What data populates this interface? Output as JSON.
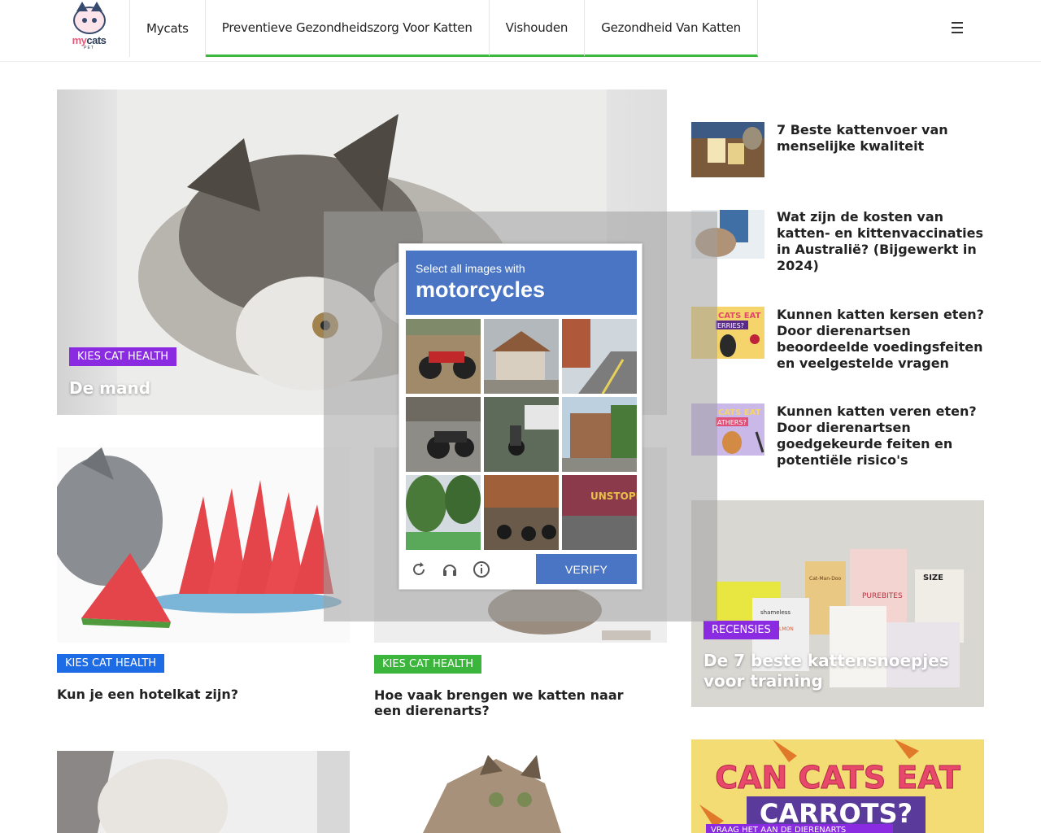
{
  "header": {
    "logo_text_a": "my",
    "logo_text_b": "cats",
    "logo_sub": "PET",
    "nav": [
      "Mycats",
      "Preventieve Gezondheidszorg Voor Katten",
      "Vishouden",
      "Gezondheid Van Katten"
    ]
  },
  "hero": {
    "badge": "KIES CAT HEALTH",
    "title": "De mand"
  },
  "cards": [
    {
      "badge": "KIES CAT HEALTH",
      "title": "Kun je een hotelkat zijn?"
    },
    {
      "badge": "KIES CAT HEALTH",
      "title": "Hoe vaak brengen we katten naar een dierenarts?"
    }
  ],
  "sidebar": {
    "items": [
      {
        "title": "7 Beste kattenvoer van menselijke kwaliteit"
      },
      {
        "title": "Wat zijn de kosten van katten- en kittenvaccinaties in Australië? (Bijgewerkt in 2024)"
      },
      {
        "title": "Kunnen katten kersen eten? Door dierenartsen beoordeelde voedingsfeiten en veelgestelde vragen",
        "thumb_text_a": "CATS EAT",
        "thumb_text_b": "ERRIES?"
      },
      {
        "title": "Kunnen katten veren eten? Door dierenartsen goedgekeurde feiten en potentiële risico's",
        "thumb_text_a": "CATS EAT",
        "thumb_text_b": "ATHERS?"
      }
    ],
    "feature": {
      "badge": "RECENSIES",
      "title": "De 7 beste kattensnoepjes voor training",
      "bag_labels": [
        "SIZE",
        "PUREBITES",
        "shameless",
        "Cat-Man-Doo",
        "SALMON"
      ]
    },
    "carrot": {
      "line1": "CAN CATS EAT",
      "line2": "CARROTS?",
      "banner": "VRAAG HET AAN DE DIERENARTS"
    }
  },
  "captcha": {
    "prompt": "Select all images with",
    "target": "motorcycles",
    "tile_text": "UNSTOPPA",
    "verify": "VERIFY",
    "icons": [
      "reload-icon",
      "audio-icon",
      "info-icon"
    ]
  }
}
